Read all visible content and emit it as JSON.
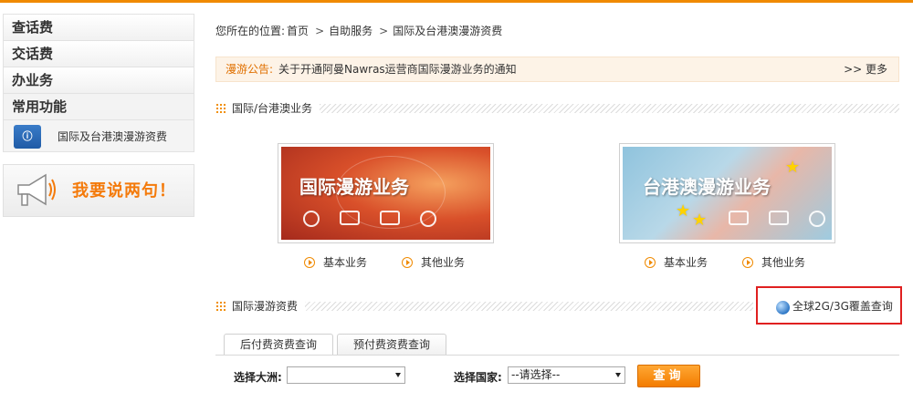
{
  "sidebar": {
    "items": [
      {
        "label": "查话费"
      },
      {
        "label": "交话费"
      },
      {
        "label": "办业务"
      },
      {
        "label": "常用功能"
      }
    ],
    "sub_item": {
      "label": "国际及台港澳漫游资费",
      "icon": "roaming-info-icon"
    },
    "feedback": {
      "label": "我要说两句！",
      "icon": "megaphone-icon"
    }
  },
  "breadcrumb": {
    "prefix": "您所在的位置:",
    "items": [
      "首页",
      "自助服务",
      "国际及台港澳漫游资费"
    ]
  },
  "notice": {
    "label": "漫游公告:",
    "text": "关于开通阿曼Nawras运营商国际漫游业务的通知",
    "more": ">> 更多"
  },
  "section_business": {
    "title": "国际/台港澳业务"
  },
  "banners": [
    {
      "title": "国际漫游业务",
      "links": [
        "基本业务",
        "其他业务"
      ]
    },
    {
      "title": "台港澳漫游业务",
      "links": [
        "基本业务",
        "其他业务"
      ]
    }
  ],
  "section_rates": {
    "title": "国际漫游资费"
  },
  "coverage": {
    "label": "全球2G/3G覆盖查询",
    "icon": "globe-icon"
  },
  "tabs": [
    {
      "label": "后付费资费查询",
      "active": true
    },
    {
      "label": "预付费资费查询",
      "active": false
    }
  ],
  "query": {
    "continent_label": "选择大洲:",
    "continent_value": "",
    "country_label": "选择国家:",
    "country_value": "--请选择--",
    "button_label": "查询"
  },
  "colors": {
    "accent": "#f08a00",
    "highlight_border": "#e02020"
  }
}
